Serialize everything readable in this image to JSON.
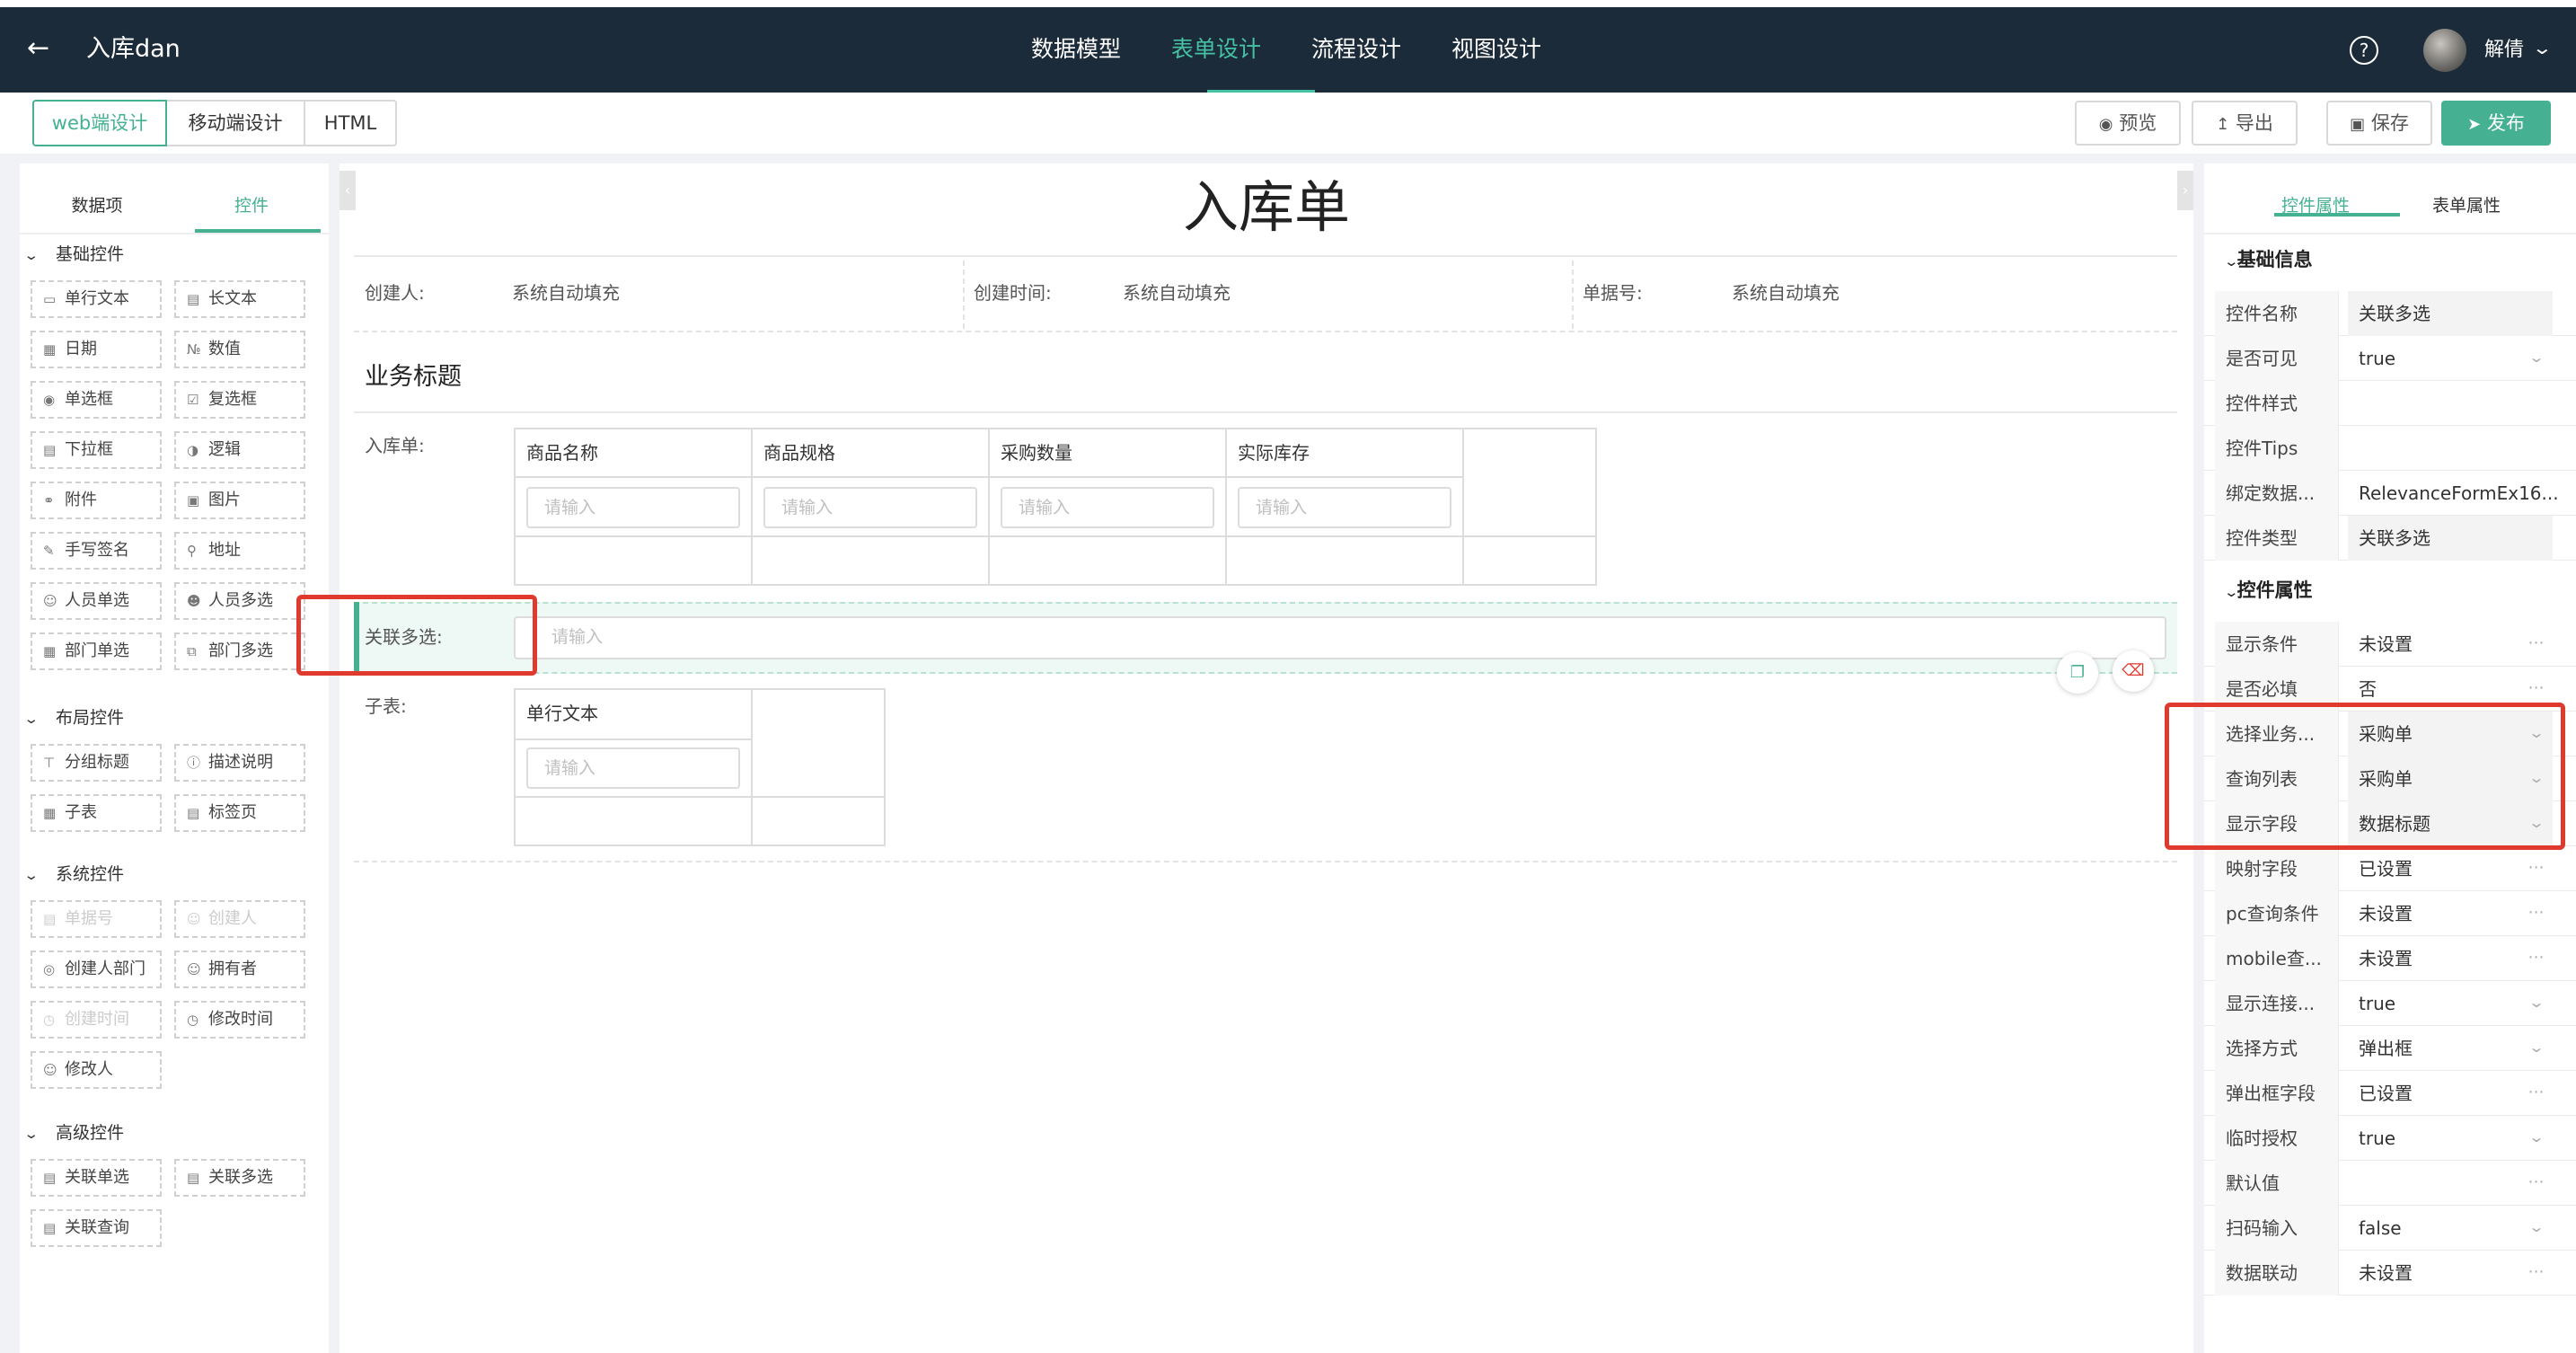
{
  "header": {
    "back_icon": "arrow-left-icon",
    "app_title": "入库dan",
    "nav": [
      {
        "label": "数据模型",
        "active": false
      },
      {
        "label": "表单设计",
        "active": true
      },
      {
        "label": "流程设计",
        "active": false
      },
      {
        "label": "视图设计",
        "active": false
      }
    ],
    "help_icon": "question-circle-icon",
    "user_name": "解倩",
    "accent_color": "#45c2a3",
    "background_color": "#1c2b3a"
  },
  "toolbar": {
    "modes": [
      "web端设计",
      "移动端设计",
      "HTML"
    ],
    "active_mode": "web端设计",
    "actions": {
      "preview": "预览",
      "export": "导出",
      "save": "保存",
      "publish": "发布"
    },
    "publish_color": "#45b092"
  },
  "left_panel": {
    "tabs": [
      "数据项",
      "控件"
    ],
    "active_tab": "控件",
    "groups": [
      {
        "title": "基础控件",
        "items": [
          "单行文本",
          "长文本",
          "日期",
          "数值",
          "单选框",
          "复选框",
          "下拉框",
          "逻辑",
          "附件",
          "图片",
          "手写签名",
          "地址",
          "人员单选",
          "人员多选",
          "部门单选",
          "部门多选"
        ]
      },
      {
        "title": "布局控件",
        "items": [
          "分组标题",
          "描述说明",
          "子表",
          "标签页"
        ]
      },
      {
        "title": "系统控件",
        "items": [
          "单据号",
          "创建人",
          "创建人部门",
          "拥有者",
          "创建时间",
          "修改时间",
          "修改人"
        ]
      },
      {
        "title": "高级控件",
        "items": [
          "关联单选",
          "关联多选",
          "关联查询"
        ]
      }
    ]
  },
  "form": {
    "title": "入库单",
    "meta": [
      {
        "label": "创建人:",
        "value": "系统自动填充"
      },
      {
        "label": "创建时间:",
        "value": "系统自动填充"
      },
      {
        "label": "单据号:",
        "value": "系统自动填充"
      }
    ],
    "section_title": "业务标题",
    "subtable1": {
      "label": "入库单:",
      "columns": [
        "商品名称",
        "商品规格",
        "采购数量",
        "实际库存"
      ],
      "placeholder": "请输入"
    },
    "relation_field": {
      "label": "关联多选:",
      "placeholder": "请输入"
    },
    "subtable2": {
      "label": "子表:",
      "columns": [
        "单行文本"
      ],
      "placeholder": "请输入"
    }
  },
  "right_panel": {
    "tabs": [
      "控件属性",
      "表单属性"
    ],
    "active_tab": "控件属性",
    "basic_title": "基础信息",
    "basic": [
      {
        "key": "控件名称",
        "value": "关联多选",
        "extra": ""
      },
      {
        "key": "是否可见",
        "value": "true",
        "extra": "chevron"
      },
      {
        "key": "控件样式",
        "value": "",
        "extra": ""
      },
      {
        "key": "控件Tips",
        "value": "",
        "extra": ""
      },
      {
        "key": "绑定数据...",
        "value": "RelevanceFormEx16...",
        "extra": ""
      },
      {
        "key": "控件类型",
        "value": "关联多选",
        "extra": "grey"
      }
    ],
    "props_title": "控件属性",
    "props": [
      {
        "key": "显示条件",
        "value": "未设置",
        "extra": "dots"
      },
      {
        "key": "是否必填",
        "value": "否",
        "extra": "dots"
      },
      {
        "key": "选择业务...",
        "value": "采购单",
        "extra": "chevron"
      },
      {
        "key": "查询列表",
        "value": "采购单",
        "extra": "chevron"
      },
      {
        "key": "显示字段",
        "value": "数据标题",
        "extra": "chevron"
      },
      {
        "key": "映射字段",
        "value": "已设置",
        "extra": "dots"
      },
      {
        "key": "pc查询条件",
        "value": "未设置",
        "extra": "dots"
      },
      {
        "key": "mobile查...",
        "value": "未设置",
        "extra": "dots"
      },
      {
        "key": "显示连接...",
        "value": "true",
        "extra": "chevron"
      },
      {
        "key": "选择方式",
        "value": "弹出框",
        "extra": "chevron"
      },
      {
        "key": "弹出框字段",
        "value": "已设置",
        "extra": "dots"
      },
      {
        "key": "临时授权",
        "value": "true",
        "extra": "chevron"
      },
      {
        "key": "默认值",
        "value": "",
        "extra": "dots"
      },
      {
        "key": "扫码输入",
        "value": "false",
        "extra": "chevron"
      },
      {
        "key": "数据联动",
        "value": "未设置",
        "extra": "dots"
      }
    ]
  },
  "annotation_color": "#e03a2f"
}
